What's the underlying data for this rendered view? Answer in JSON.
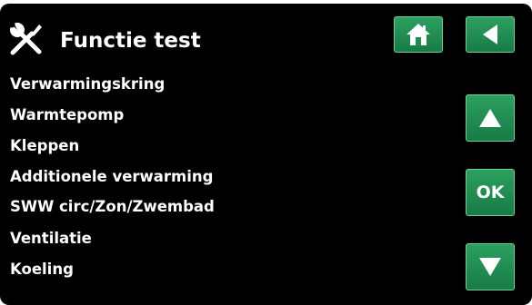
{
  "header": {
    "icon": "tools-icon",
    "title": "Functie test"
  },
  "menu": {
    "items": [
      {
        "label": "Verwarmingskring"
      },
      {
        "label": "Warmtepomp"
      },
      {
        "label": "Kleppen"
      },
      {
        "label": "Additionele verwarming"
      },
      {
        "label": "SWW circ/Zon/Zwembad"
      },
      {
        "label": "Ventilatie"
      },
      {
        "label": "Koeling"
      }
    ]
  },
  "buttons": {
    "home": {
      "icon": "home-icon"
    },
    "back": {
      "icon": "back-arrow-icon"
    },
    "up": {
      "icon": "up-arrow-icon"
    },
    "ok": {
      "label": "OK"
    },
    "down": {
      "icon": "down-arrow-icon"
    }
  },
  "colors": {
    "background": "#000000",
    "text": "#ffffff",
    "button": "#1f8c52"
  }
}
